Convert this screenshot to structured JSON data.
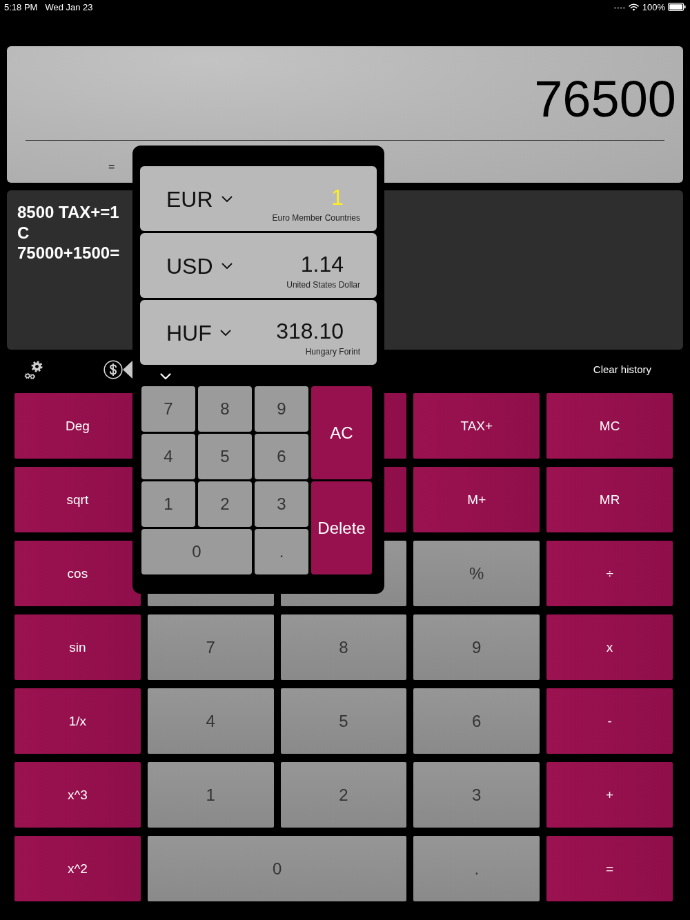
{
  "status_bar": {
    "time": "5:18 PM",
    "date": "Wed Jan 23",
    "battery": "100%"
  },
  "display": {
    "value": "76500",
    "expression": "="
  },
  "history": {
    "lines": [
      "8500 TAX+=1",
      "C",
      "75000+1500="
    ]
  },
  "toolbar": {
    "clear_history": "Clear history"
  },
  "keypad": {
    "keys": [
      {
        "label": "Deg",
        "kind": "function"
      },
      {
        "kind": "covered-function"
      },
      {
        "label": "TAX+",
        "kind": "function"
      },
      {
        "label": "MC",
        "kind": "function"
      },
      {
        "label": "sqrt",
        "kind": "function"
      },
      {
        "kind": "covered-function"
      },
      {
        "label": "M+",
        "kind": "function"
      },
      {
        "label": "MR",
        "kind": "function"
      },
      {
        "label": "cos",
        "kind": "function"
      },
      {
        "kind": "digit"
      },
      {
        "kind": "digit"
      },
      {
        "label": "%",
        "kind": "digit"
      },
      {
        "label": "÷",
        "kind": "function"
      },
      {
        "label": "sin",
        "kind": "function"
      },
      {
        "label": "7",
        "kind": "digit"
      },
      {
        "label": "8",
        "kind": "digit"
      },
      {
        "label": "9",
        "kind": "digit"
      },
      {
        "label": "x",
        "kind": "function"
      },
      {
        "label": "1/x",
        "kind": "function"
      },
      {
        "label": "4",
        "kind": "digit"
      },
      {
        "label": "5",
        "kind": "digit"
      },
      {
        "label": "6",
        "kind": "digit"
      },
      {
        "label": "-",
        "kind": "function"
      },
      {
        "label": "x^3",
        "kind": "function"
      },
      {
        "label": "1",
        "kind": "digit"
      },
      {
        "label": "2",
        "kind": "digit"
      },
      {
        "label": "3",
        "kind": "digit"
      },
      {
        "label": "+",
        "kind": "function"
      },
      {
        "label": "x^2",
        "kind": "function"
      },
      {
        "label": "0",
        "kind": "wide-digit"
      },
      {
        "label": ".",
        "kind": "digit"
      },
      {
        "label": "=",
        "kind": "function"
      }
    ]
  },
  "converter": {
    "currencies": [
      {
        "code": "EUR",
        "value": "1",
        "name": "Euro Member Countries",
        "selected": true
      },
      {
        "code": "USD",
        "value": "1.14",
        "name": "United States Dollar",
        "selected": false
      },
      {
        "code": "HUF",
        "value": "318.10",
        "name": "Hungary Forint",
        "selected": false
      }
    ],
    "keys": [
      {
        "label": "7",
        "kind": "digit"
      },
      {
        "label": "8",
        "kind": "digit"
      },
      {
        "label": "9",
        "kind": "digit"
      },
      {
        "label": "AC",
        "kind": "tall-action"
      },
      {
        "label": "4",
        "kind": "digit"
      },
      {
        "label": "5",
        "kind": "digit"
      },
      {
        "label": "6",
        "kind": "digit"
      },
      {
        "label": "1",
        "kind": "digit"
      },
      {
        "label": "2",
        "kind": "digit"
      },
      {
        "label": "3",
        "kind": "digit"
      },
      {
        "label": "Delete",
        "kind": "tall-action"
      },
      {
        "label": "0",
        "kind": "wide-digit"
      },
      {
        "label": ".",
        "kind": "digit"
      }
    ]
  }
}
